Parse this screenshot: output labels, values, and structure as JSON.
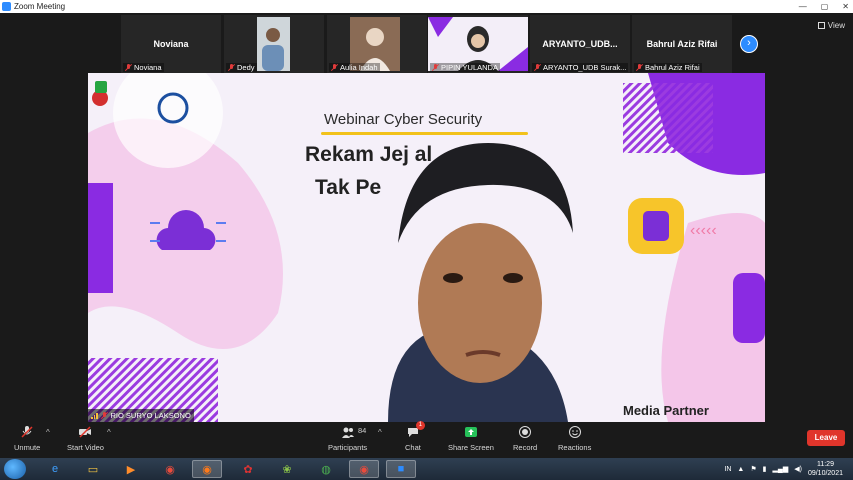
{
  "window": {
    "title": "Zoom Meeting",
    "controls": [
      "—",
      "▢",
      "✕"
    ]
  },
  "strip": {
    "participants": [
      {
        "name": "Noviana",
        "big_name": "Noviana",
        "video": false
      },
      {
        "name": "Dedy",
        "big_name": "",
        "video": true
      },
      {
        "name": "Aulia Indah",
        "big_name": "",
        "video": true
      },
      {
        "name": "PIPIN YULANDA",
        "big_name": "",
        "video": true
      },
      {
        "name": "ARYANTO_UDB Surak...",
        "big_name": "ARYANTO_UDB...",
        "video": false
      },
      {
        "name": "Bahrul Aziz Rifai",
        "big_name": "Bahrul Aziz Rifai",
        "video": false
      }
    ],
    "view_label": "View"
  },
  "main": {
    "slide_title": "Webinar Cyber Security",
    "headline_1": "Rekam Jej        al",
    "headline_2": "Tak Pe",
    "media_partner": "Media Partner",
    "speaker_name": "RIO SURYO LAKSONO"
  },
  "toolbar": {
    "unmute": "Unmute",
    "start_video": "Start Video",
    "participants": "Participants",
    "participants_count": "84",
    "chat": "Chat",
    "chat_badge": "1",
    "share_screen": "Share Screen",
    "record": "Record",
    "reactions": "Reactions",
    "leave": "Leave"
  },
  "taskbar": {
    "language": "IN",
    "time": "11:29",
    "date": "09/10/2021"
  },
  "colors": {
    "zoom_blue": "#2d8cff",
    "leave_red": "#e0352b",
    "share_green": "#26c15a",
    "slide_yellow": "#f2c21b",
    "slide_purple": "#8a2be2"
  }
}
